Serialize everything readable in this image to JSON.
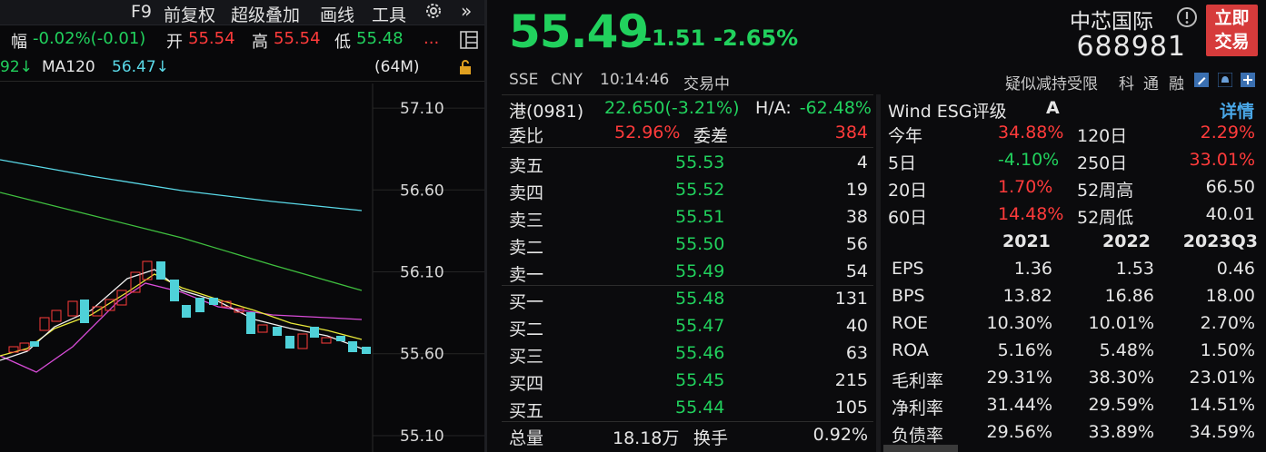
{
  "toolbar": {
    "f9": "F9",
    "restore": "前复权",
    "overlay": "超级叠加",
    "draw": "画线",
    "tools": "工具",
    "more": "»"
  },
  "quote_bar": {
    "change_label": "幅",
    "change_value": "-0.02%(-0.01)",
    "open_label": "开",
    "open_value": "55.54",
    "high_label": "高",
    "high_value": "55.54",
    "low_label": "低",
    "low_value": "55.48",
    "ellipsis": "..."
  },
  "ma_bar": {
    "ma_prev_tail": "92↓",
    "ma120_label": "MA120",
    "ma120_value": "56.47↓",
    "volume": "(64M)"
  },
  "chart_data": {
    "type": "candlestick",
    "y_ticks": [
      "57.10",
      "56.60",
      "56.10",
      "55.60",
      "55.10"
    ],
    "ylim": [
      55.0,
      57.25
    ]
  },
  "header": {
    "price": "55.49",
    "change": "-1.51",
    "change_pct": "-2.65%",
    "name": "中芯国际",
    "code": "688981",
    "trade_btn_line1": "立即",
    "trade_btn_line2": "交易"
  },
  "sub_header": {
    "exchange": "SSE",
    "currency": "CNY",
    "time": "10:14:46",
    "status": "交易中",
    "notice": "疑似减持受限",
    "tag1": "科",
    "tag2": "通",
    "tag3": "融"
  },
  "order_book": {
    "hk_label": "港(0981)",
    "hk_value": "22.650(-3.21%)",
    "ha_label": "H/A:",
    "ha_value": "-62.48%",
    "weibi_label": "委比",
    "weibi_value": "52.96%",
    "weicha_label": "委差",
    "weicha_value": "384",
    "asks": [
      {
        "label": "卖五",
        "price": "55.53",
        "vol": "4"
      },
      {
        "label": "卖四",
        "price": "55.52",
        "vol": "19"
      },
      {
        "label": "卖三",
        "price": "55.51",
        "vol": "38"
      },
      {
        "label": "卖二",
        "price": "55.50",
        "vol": "56"
      },
      {
        "label": "卖一",
        "price": "55.49",
        "vol": "54"
      }
    ],
    "bids": [
      {
        "label": "买一",
        "price": "55.48",
        "vol": "131"
      },
      {
        "label": "买二",
        "price": "55.47",
        "vol": "40"
      },
      {
        "label": "买三",
        "price": "55.46",
        "vol": "63"
      },
      {
        "label": "买四",
        "price": "55.45",
        "vol": "215"
      },
      {
        "label": "买五",
        "price": "55.44",
        "vol": "105"
      }
    ],
    "total_label": "总量",
    "total_value": "18.18万",
    "turnover_label": "换手",
    "turnover_value": "0.92%"
  },
  "fin_panel": {
    "esg_label": "Wind ESG评级",
    "esg_value": "A",
    "detail": "详情",
    "perf": [
      {
        "l1": "今年",
        "v1": "34.88%",
        "c1": "red",
        "l2": "120日",
        "v2": "2.29%",
        "c2": "red"
      },
      {
        "l1": "5日",
        "v1": "-4.10%",
        "c1": "green",
        "l2": "250日",
        "v2": "33.01%",
        "c2": "red"
      },
      {
        "l1": "20日",
        "v1": "1.70%",
        "c1": "red",
        "l2": "52周高",
        "v2": "66.50",
        "c2": "white"
      },
      {
        "l1": "60日",
        "v1": "14.48%",
        "c1": "red",
        "l2": "52周低",
        "v2": "40.01",
        "c2": "white"
      }
    ],
    "years": [
      "2021",
      "2022",
      "2023Q3"
    ],
    "metrics": [
      {
        "label": "EPS",
        "v": [
          "1.36",
          "1.53",
          "0.46"
        ]
      },
      {
        "label": "BPS",
        "v": [
          "13.82",
          "16.86",
          "18.00"
        ]
      },
      {
        "label": "ROE",
        "v": [
          "10.30%",
          "10.01%",
          "2.70%"
        ]
      },
      {
        "label": "ROA",
        "v": [
          "5.16%",
          "5.48%",
          "1.50%"
        ]
      },
      {
        "label": "毛利率",
        "v": [
          "29.31%",
          "38.30%",
          "23.01%"
        ]
      },
      {
        "label": "净利率",
        "v": [
          "31.44%",
          "29.59%",
          "14.51%"
        ]
      },
      {
        "label": "负债率",
        "v": [
          "29.56%",
          "33.89%",
          "34.59%"
        ]
      }
    ]
  }
}
